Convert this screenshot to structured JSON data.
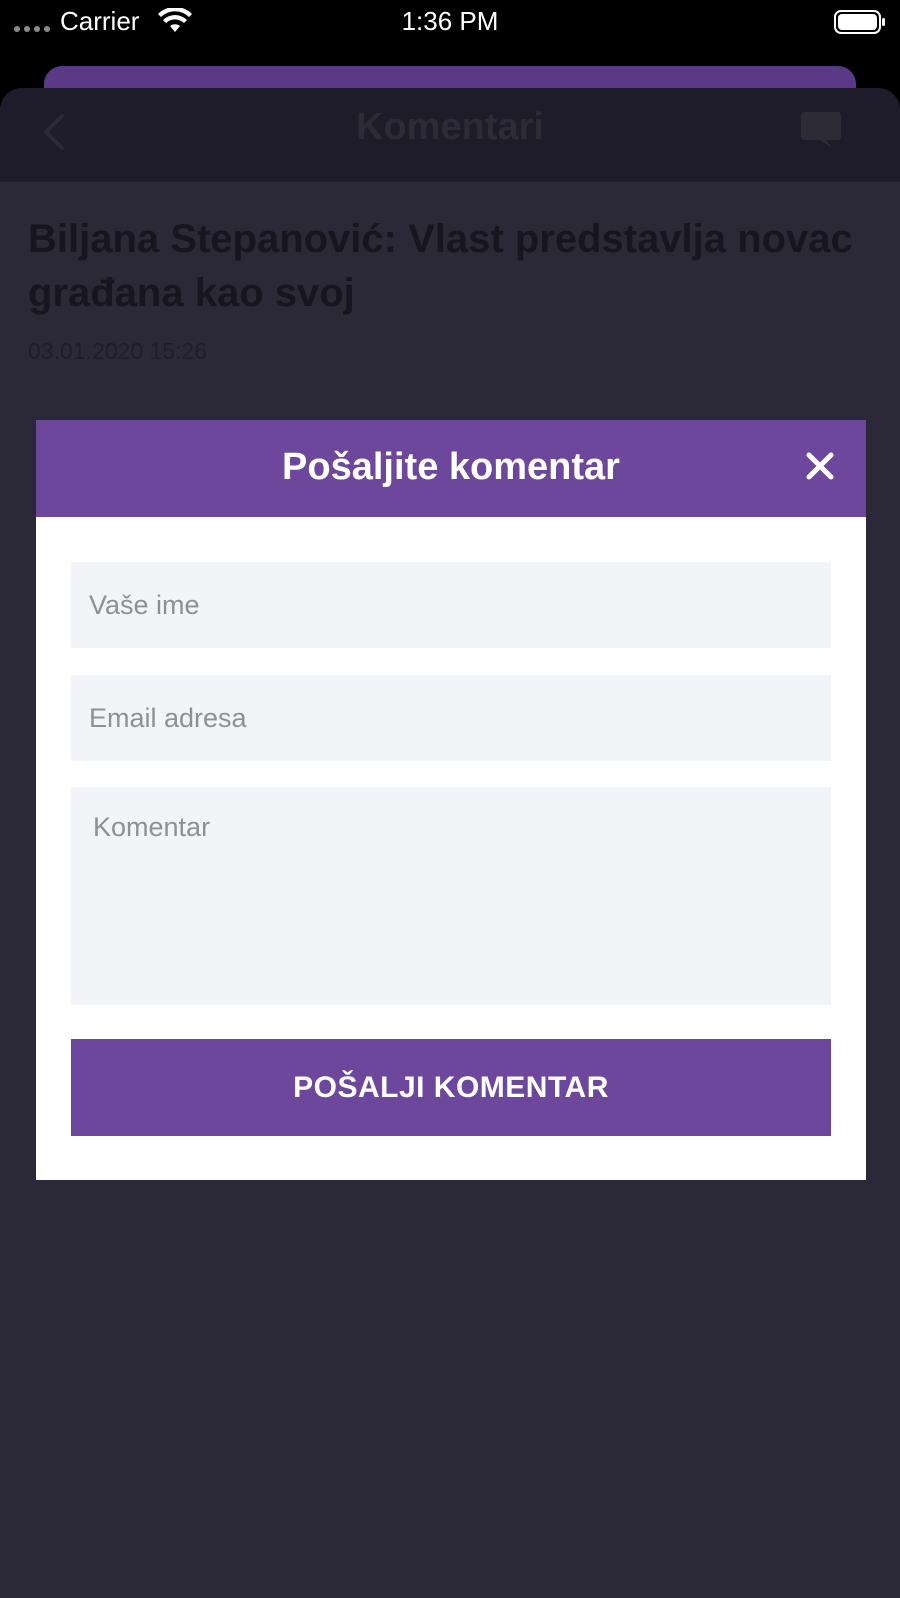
{
  "status_bar": {
    "carrier": "Carrier",
    "time": "1:36 PM"
  },
  "navbar": {
    "title": "Komentari",
    "back_icon": "chevron-left-icon",
    "comment_icon": "comment-bubble-icon"
  },
  "article": {
    "title": "Biljana Stepanović: Vlast predstavlja novac građana kao svoj",
    "date": "03.01.2020 15:26"
  },
  "dialog": {
    "title": "Pošaljite komentar",
    "close_icon": "close-icon",
    "name_placeholder": "Vaše ime",
    "email_placeholder": "Email adresa",
    "comment_placeholder": "Komentar",
    "submit_label": "POŠALJI KOMENTAR"
  },
  "colors": {
    "accent": "#6d479c",
    "background": "#2b2938",
    "navbar": "#1e1b2b",
    "input_bg": "#f2f4f8"
  }
}
